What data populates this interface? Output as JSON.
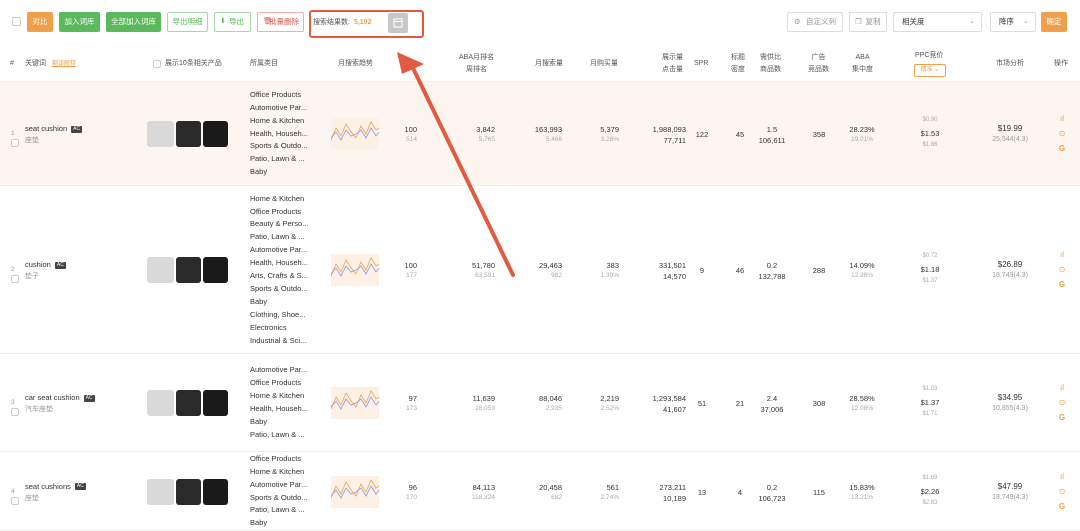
{
  "toolbar": {
    "compare": "对比",
    "add_to_library": "加入词库",
    "add_all_to_library": "全部加入词库",
    "export_details": "导出明细",
    "export": "导出",
    "batch_delete": "批量删除",
    "search_results_label": "搜索结果数:",
    "search_results_count": "5,192",
    "custom_columns": "自定义列",
    "copy": "复制",
    "sort_by": "相关度",
    "order": "降序",
    "confirm": "确定"
  },
  "header": {
    "idx": "#",
    "keyword": "关键词",
    "keyword_tag": "翻译解释",
    "show_products": "展示10条相关产品",
    "category": "所属类目",
    "monthly_trend": "月搜索趋势",
    "aba_rank_1": "ABA月排名",
    "aba_rank_2": "周排名",
    "monthly_search": "月搜索量",
    "monthly_buy": "月购买量",
    "impressions_1": "展示量",
    "impressions_2": "点击量",
    "spr": "SPR",
    "title_1": "标题",
    "title_2": "密度",
    "supply_1": "需供比",
    "supply_2": "商品数",
    "ad_1": "广告",
    "ad_2": "竞品数",
    "aba_conc_1": "ABA",
    "aba_conc_2": "集中度",
    "ppc": "PPC竞价",
    "ppc_sel": "精准",
    "market": "市场分析",
    "ops": "操作"
  },
  "rows": [
    {
      "idx": "1",
      "keyword": "seat cushion",
      "tag": "AC",
      "cn": "座垫",
      "categories": [
        "Office Products",
        "Automotive Par...",
        "Home & Kitchen",
        "Health, Househ...",
        "Sports & Outdo...",
        "Patio, Lawn & ...",
        "Baby"
      ],
      "relevance": "100",
      "relevance_sub": "514",
      "aba_month": "3,842",
      "aba_week": "5,765",
      "search": "163,993",
      "search_sub": "5,466",
      "buy": "5,379",
      "buy_pct": "3.28%",
      "impr": "1,988,093",
      "clicks": "77,711",
      "spr": "122",
      "title_density": "45",
      "supply": "1.5",
      "products": "106,611",
      "ads": "358",
      "conc": "28.23%",
      "conc_sub": "19.01%",
      "ppc_top": "$0.90",
      "ppc_mid": "$1.53",
      "ppc_bot": "$1.86",
      "price": "$19.99",
      "rating": "25,544(4.3)"
    },
    {
      "idx": "2",
      "keyword": "cushion",
      "tag": "AC",
      "cn": "垫子",
      "categories": [
        "Home & Kitchen",
        "Office Products",
        "Beauty & Perso...",
        "Patio, Lawn & ...",
        "Automotive Par...",
        "Health, Househ...",
        "Arts, Crafts & S...",
        "Sports & Outdo...",
        "Baby",
        "Clothing, Shoe...",
        "Electronics",
        "Industrial & Sci..."
      ],
      "relevance": "100",
      "relevance_sub": "177",
      "aba_month": "51,780",
      "aba_week": "63,591",
      "search": "29,463",
      "search_sub": "982",
      "buy": "383",
      "buy_pct": "1.30%",
      "impr": "331,501",
      "clicks": "14,570",
      "spr": "9",
      "title_density": "46",
      "supply": "0.2",
      "products": "132,788",
      "ads": "288",
      "conc": "14.09%",
      "conc_sub": "12.38%",
      "ppc_top": "$0.72",
      "ppc_mid": "$1.18",
      "ppc_bot": "$1.37",
      "price": "$26.89",
      "rating": "18,749(4.3)"
    },
    {
      "idx": "3",
      "keyword": "car seat cushion",
      "tag": "AC",
      "cn": "汽车座垫",
      "categories": [
        "Automotive Par...",
        "Office Products",
        "Home & Kitchen",
        "Health, Househ...",
        "Baby",
        "Patio, Lawn & ..."
      ],
      "relevance": "97",
      "relevance_sub": "173",
      "aba_month": "11,639",
      "aba_week": "16,053",
      "search": "88,046",
      "search_sub": "2,935",
      "buy": "2,219",
      "buy_pct": "2.52%",
      "impr": "1,293,584",
      "clicks": "41,607",
      "spr": "51",
      "title_density": "21",
      "supply": "2.4",
      "products": "37,006",
      "ads": "308",
      "conc": "28.58%",
      "conc_sub": "12.08%",
      "ppc_top": "$1.03",
      "ppc_mid": "$1.37",
      "ppc_bot": "$1.71",
      "price": "$34.95",
      "rating": "10,855(4.3)"
    },
    {
      "idx": "4",
      "keyword": "seat cushions",
      "tag": "AC",
      "cn": "座垫",
      "categories": [
        "Office Products",
        "Home & Kitchen",
        "Automotive Par...",
        "Sports & Outdo...",
        "Patio, Lawn & ...",
        "Baby"
      ],
      "relevance": "96",
      "relevance_sub": "170",
      "aba_month": "84,113",
      "aba_week": "118,824",
      "search": "20,458",
      "search_sub": "682",
      "buy": "561",
      "buy_pct": "2.74%",
      "impr": "273,211",
      "clicks": "10,189",
      "spr": "13",
      "title_density": "4",
      "supply": "0.2",
      "products": "106,723",
      "ads": "115",
      "conc": "15.83%",
      "conc_sub": "13.21%",
      "ppc_top": "$1.69",
      "ppc_mid": "$2.26",
      "ppc_bot": "$2.83",
      "price": "$47.99",
      "rating": "18,749(4.3)"
    }
  ],
  "colors": {
    "accent": "#f0a04b",
    "green": "#5cb85c",
    "highlight_row": "#fdf6f0",
    "annotation_arrow": "#e25a3f"
  }
}
